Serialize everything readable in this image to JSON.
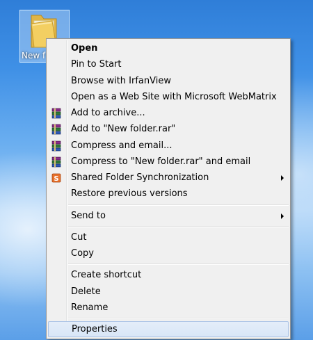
{
  "desktop": {
    "folder_label": "New f"
  },
  "menu": {
    "items": [
      {
        "label": "Open"
      },
      {
        "label": "Pin to Start"
      },
      {
        "label": "Browse with IrfanView"
      },
      {
        "label": "Open as a Web Site with Microsoft WebMatrix"
      },
      {
        "label": "Add to archive..."
      },
      {
        "label": "Add to \"New folder.rar\""
      },
      {
        "label": "Compress and email..."
      },
      {
        "label": "Compress to \"New folder.rar\" and email"
      },
      {
        "label": "Shared Folder Synchronization"
      },
      {
        "label": "Restore previous versions"
      },
      {
        "label": "Send to"
      },
      {
        "label": "Cut"
      },
      {
        "label": "Copy"
      },
      {
        "label": "Create shortcut"
      },
      {
        "label": "Delete"
      },
      {
        "label": "Rename"
      },
      {
        "label": "Properties"
      }
    ],
    "icons": {
      "winrar": "winrar-books-icon",
      "sync": "sharepoint-sync-icon"
    },
    "highlighted": "Properties",
    "colors": {
      "menu_bg": "#f0f0f0",
      "highlight_bg": "#dfe9f8",
      "highlight_border": "#a9c2e6"
    }
  }
}
